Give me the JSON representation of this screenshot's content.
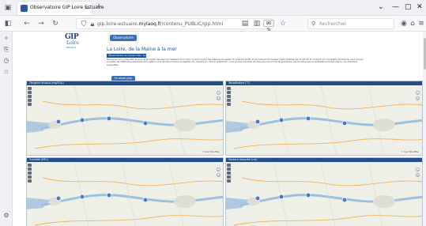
{
  "browser": {
    "tab_title": "Observatoire GIP Loire Estuaire",
    "tab_close": "×",
    "new_tab": "+",
    "url_prefix": "gip.loire-estuaire.",
    "url_domain": "mylaoq.fr",
    "url_path": "/contenu_PUBLIC/gip.html",
    "zoom": "90 %",
    "search_placeholder": "Rechercher",
    "icons": [
      "back-icon",
      "forward-icon",
      "reload-icon",
      "lock-icon",
      "bookmark-star-icon",
      "reader-icon",
      "extensions-icon",
      "menu-icon"
    ]
  },
  "header": {
    "logo_gip": "GIP",
    "logo_loire": "Loire",
    "logo_estuaire": "Estuaire",
    "observ_button": "Observatoire",
    "heading": "La Loire, de la Maine à la mer",
    "subheading": "Observatoire en temps réel / hydrologie",
    "intro": "Bienvenue sur le dispositif de suivi de la qualité des eaux de l'estuaire de la Loire. Vous trouverez des mesures du réseau de mesures SyVEL et les mesures de hauteur d'eau réalisées par le GIP LE. En cliquant sur une station de mesure, vous pouvez consulter les différents paramètres de la station et la dernière mesure enregistrée. En cliquant sur \"Voir le graphique\", vous pouvez visualiser les mesures sous forme de graphique. Les données sont consultables en temps réel sur les 4 stations présentées.",
    "learn_button": "En savoir plus"
  },
  "maps": [
    {
      "title": "Oxygène dissous (mg/O2/L)"
    },
    {
      "title": "Température (°C)"
    },
    {
      "title": "Turbidité (NTU)"
    },
    {
      "title": "Hauteur mesurée (cm)"
    }
  ],
  "map_scale": "© OpenStreetMap",
  "colors": {
    "accent": "#1f4f8f",
    "button": "#3b6db5",
    "river": "#9cc0e0",
    "road": "#f3b25a",
    "station": "#4a78c8"
  }
}
